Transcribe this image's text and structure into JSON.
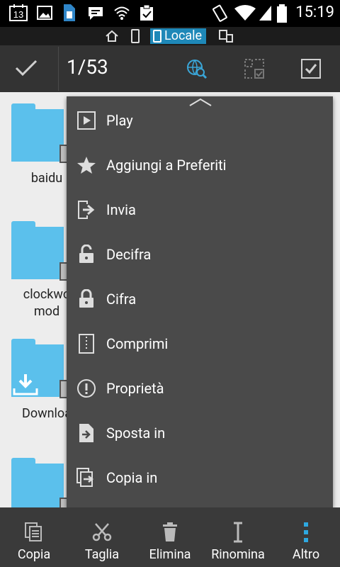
{
  "status_bar": {
    "notification_count": "13",
    "time": "15:19"
  },
  "location_bar": {
    "active_label": "Locale"
  },
  "action_bar": {
    "selection_count": "1/53"
  },
  "folders": [
    {
      "label": "baidu"
    },
    {
      "label": "clockwo mod"
    },
    {
      "label": "Downloa"
    },
    {
      "label": ""
    }
  ],
  "menu": {
    "items": [
      {
        "label": "Play",
        "icon": "play-icon"
      },
      {
        "label": "Aggiungi a Preferiti",
        "icon": "star-icon"
      },
      {
        "label": "Invia",
        "icon": "send-icon"
      },
      {
        "label": "Decifra",
        "icon": "unlock-icon"
      },
      {
        "label": "Cifra",
        "icon": "lock-icon"
      },
      {
        "label": "Comprimi",
        "icon": "zip-icon"
      },
      {
        "label": "Proprietà",
        "icon": "info-icon"
      },
      {
        "label": "Sposta in",
        "icon": "move-icon"
      },
      {
        "label": "Copia in",
        "icon": "copy-to-icon"
      }
    ]
  },
  "bottom_bar": {
    "items": [
      {
        "label": "Copia",
        "icon": "copy-icon"
      },
      {
        "label": "Taglia",
        "icon": "scissors-icon"
      },
      {
        "label": "Elimina",
        "icon": "trash-icon"
      },
      {
        "label": "Rinomina",
        "icon": "rename-icon"
      },
      {
        "label": "Altro",
        "icon": "more-icon"
      }
    ]
  },
  "colors": {
    "accent": "#1e88b8",
    "folder": "#5bc0ec",
    "menu_bg": "#4a4a4a",
    "actionbar_bg": "#333333"
  }
}
